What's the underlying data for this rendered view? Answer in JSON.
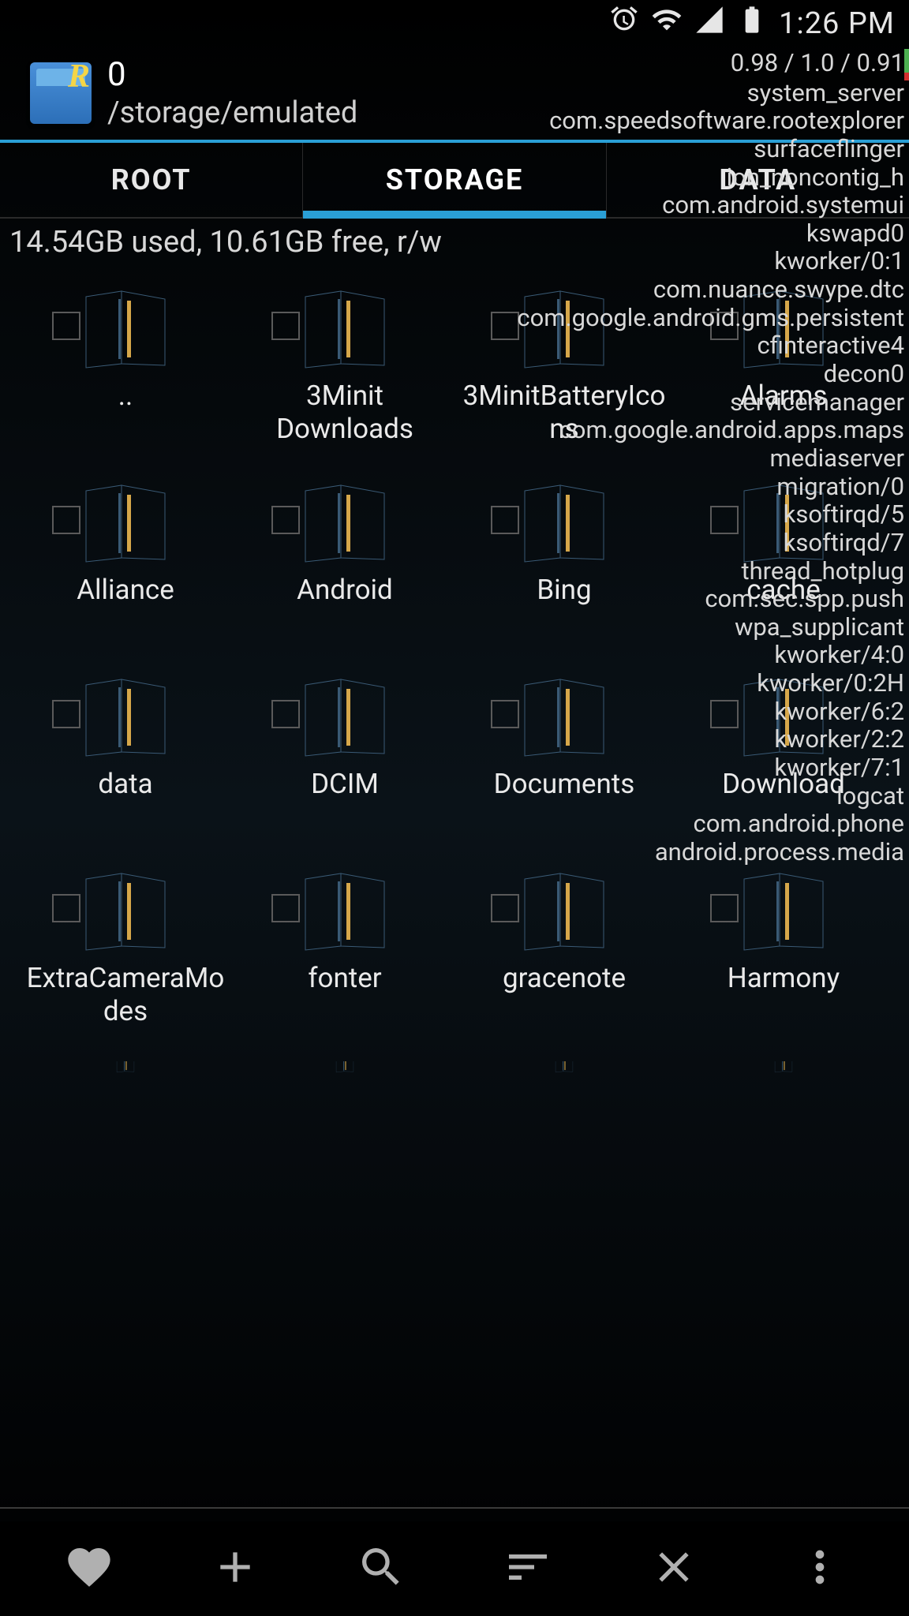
{
  "status": {
    "time": "1:26 PM"
  },
  "header": {
    "title": "0",
    "path": "/storage/emulated"
  },
  "tabs": [
    {
      "label": "ROOT",
      "active": false
    },
    {
      "label": "STORAGE",
      "active": true
    },
    {
      "label": "DATA",
      "active": false
    }
  ],
  "storage_info": "14.54GB used, 10.61GB free, r/w",
  "folders": [
    {
      "name": ".."
    },
    {
      "name": "3Minit Downloads"
    },
    {
      "name": "3MinitBatteryIcons"
    },
    {
      "name": "Alarms"
    },
    {
      "name": "Alliance"
    },
    {
      "name": "Android"
    },
    {
      "name": "Bing"
    },
    {
      "name": "cache"
    },
    {
      "name": "data"
    },
    {
      "name": "DCIM"
    },
    {
      "name": "Documents"
    },
    {
      "name": "Download"
    },
    {
      "name": "ExtraCameraModes"
    },
    {
      "name": "fonter"
    },
    {
      "name": "gracenote"
    },
    {
      "name": "Harmony"
    }
  ],
  "overlay": {
    "stats": "0.98 / 1.0 / 0.91",
    "processes": [
      "system_server",
      "com.speedsoftware.rootexplorer",
      "surfaceflinger",
      "ion_noncontig_h",
      "com.android.systemui",
      "kswapd0",
      "kworker/0:1",
      "com.nuance.swype.dtc",
      "com.google.android.gms.persistent",
      "cfinteractive4",
      "decon0",
      "servicemanager",
      "com.google.android.apps.maps",
      "mediaserver",
      "migration/0",
      "ksoftirqd/5",
      "ksoftirqd/7",
      "thread_hotplug",
      "com.sec.spp.push",
      "wpa_supplicant",
      "kworker/4:0",
      "kworker/0:2H",
      "kworker/6:2",
      "kworker/2:2",
      "kworker/7:1",
      "logcat",
      "com.android.phone",
      "android.process.media"
    ]
  }
}
